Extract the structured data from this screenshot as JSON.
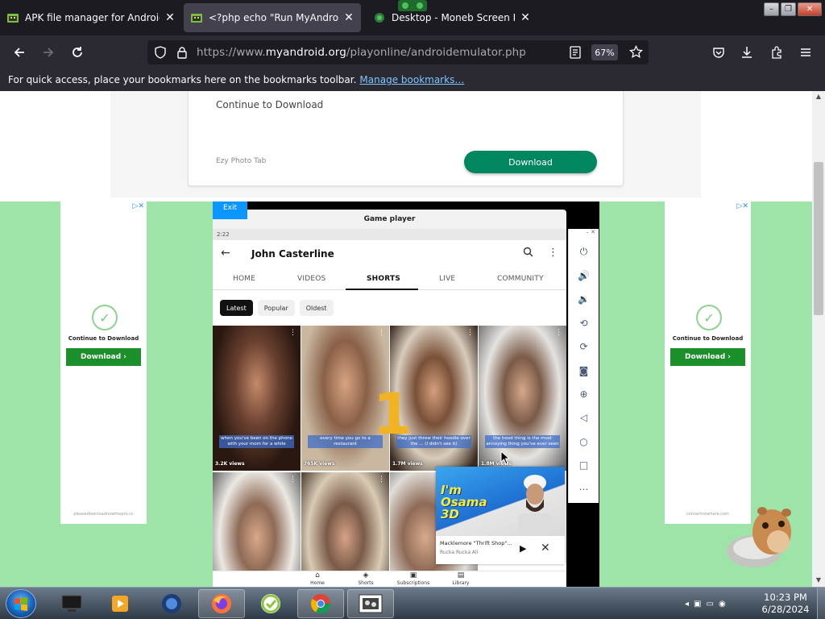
{
  "browser": {
    "tabs": [
      {
        "title": "APK file manager for Android e",
        "active": false
      },
      {
        "title": "<?php echo \"Run MyAndroid\";",
        "active": true
      },
      {
        "title": "Desktop - Moneb Screen Rec",
        "active": false
      }
    ],
    "url_prefix": "https://www.",
    "url_domain": "myandroid.org",
    "url_path": "/playonline/androidemulator.php",
    "zoom": "67%",
    "bookmarks_text": "For quick access, place your bookmarks here on the bookmarks toolbar.",
    "bookmarks_link": "Manage bookmarks…"
  },
  "top_ad": {
    "heading": "Continue to Download",
    "source": "Ezy Photo Tab",
    "button": "Download"
  },
  "side_ads": {
    "continue_text": "Continue to Download",
    "button": "Download ›",
    "adchoices": "▷✕",
    "left_url": "pleasedownloadnowthepro.cc",
    "right_url": "convertnowhere.com"
  },
  "emulator": {
    "exit_label": "Exit",
    "window_title": "Game player",
    "status_time": "2:22",
    "channel": "John Casterline",
    "tabs": [
      "HOME",
      "VIDEOS",
      "SHORTS",
      "LIVE",
      "COMMUNITY"
    ],
    "active_tab": "SHORTS",
    "filters": [
      "Latest",
      "Popular",
      "Oldest"
    ],
    "active_filter": "Latest",
    "overlay_number": "1",
    "shorts": [
      {
        "caption": "when you've been on the phone with your mom for a while",
        "views": "3.2K views"
      },
      {
        "caption": "every time you go to a restaurant",
        "views": "765K views"
      },
      {
        "caption": "they just threw their hoodie over the ... (I didn't see it)",
        "views": "1.7M views"
      },
      {
        "caption": "the hood thing is the most annoying thing you've ever seen",
        "views": "1.8M views"
      },
      {
        "caption": "",
        "views": ""
      },
      {
        "caption": "",
        "views": ""
      },
      {
        "caption": "",
        "views": ""
      }
    ],
    "bottom_nav": [
      "Home",
      "Shorts",
      "Subscriptions",
      "Library"
    ],
    "mini_player": {
      "art_title": "I'm Osama 3D",
      "song": "Macklemore \"Thrift Shop\"...",
      "artist": "Rucka Rucka Ali"
    }
  },
  "taskbar": {
    "time": "10:23 PM",
    "date": "6/28/2024"
  },
  "colors": {
    "browser_bg": "#1c1b22",
    "toolbar_bg": "#2b2a33",
    "download_green": "#01875f",
    "ad_green": "#1b8f2a",
    "page_green": "#9ee3a7",
    "exit_blue": "#0b96ff"
  }
}
